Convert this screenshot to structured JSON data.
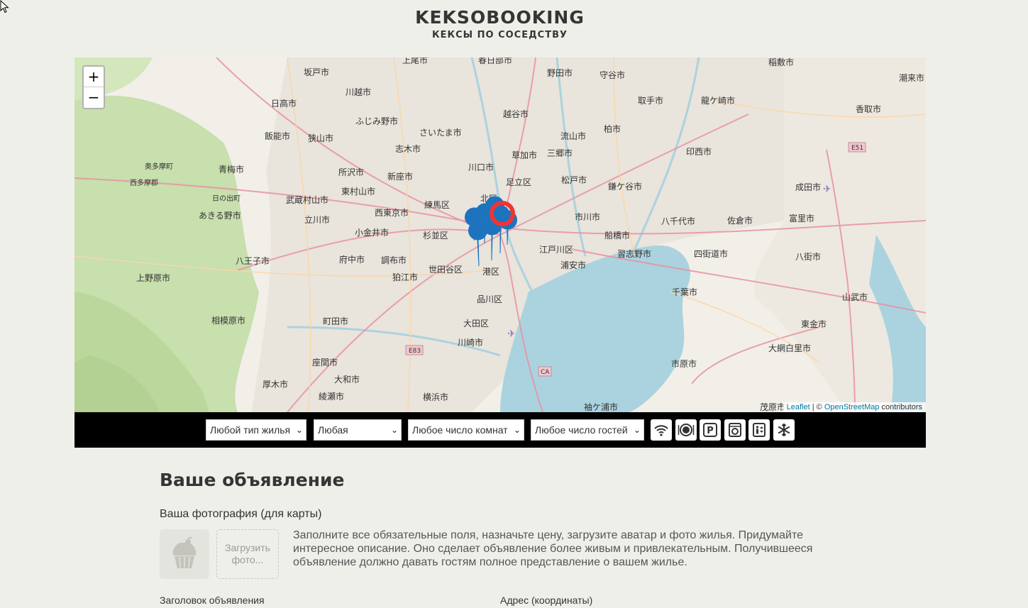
{
  "header": {
    "logo": "KEKSOBOOKING",
    "tagline": "КЕКСЫ ПО СОСЕДСТВУ"
  },
  "map": {
    "zoom_in_label": "+",
    "zoom_out_label": "−",
    "attribution": {
      "leaflet": "Leaflet",
      "separator": " | © ",
      "osm": "OpenStreetMap",
      "suffix": " contributors"
    },
    "main_pin_color": "#ee3535",
    "ad_pin_color": "#1e73be",
    "place_labels": [
      "坂戸市",
      "川越市",
      "日高市",
      "上尾市",
      "春日部市",
      "野田市",
      "守谷市",
      "稲敷市",
      "潮来市",
      "ふじみ野市",
      "越谷市",
      "取手市",
      "龍ケ崎市",
      "飯能市",
      "狭山市",
      "さいたま市",
      "柏市",
      "流山市",
      "志木市",
      "草加市",
      "三郷市",
      "印西市",
      "香取市",
      "奥多摩町",
      "青梅市",
      "所沢市",
      "新座市",
      "川口市",
      "足立区",
      "松戸市",
      "鎌ケ谷市",
      "成田市",
      "東村山市",
      "西多摩郡",
      "日の出町",
      "武蔵村山市",
      "練馬区",
      "北区",
      "市川市",
      "八千代市",
      "佐倉市",
      "富里市",
      "あきる野市",
      "立川市",
      "西東京市",
      "船橋市",
      "小金井市",
      "杉並区",
      "江戸川区",
      "習志野市",
      "四街道市",
      "八街市",
      "八王子市",
      "府中市",
      "調布市",
      "世田谷区",
      "港区",
      "浦安市",
      "上野原市",
      "狛江市",
      "品川区",
      "千葉市",
      "山武市",
      "相模原市",
      "町田市",
      "大田区",
      "東金市",
      "川崎市",
      "大網白里市",
      "座間市",
      "厚木市",
      "大和市",
      "市原市",
      "綾瀬市",
      "横浜市",
      "袖ケ浦市",
      "茂原市"
    ],
    "road_labels": [
      "E51",
      "E83",
      "CA"
    ]
  },
  "filters": {
    "housing_type": "Любой тип жилья",
    "price": "Любая",
    "rooms": "Любое число комнат",
    "guests": "Любое число гостей",
    "features": [
      "wifi-icon",
      "dishwasher-icon",
      "parking-icon",
      "washer-icon",
      "elevator-icon",
      "conditioner-icon"
    ]
  },
  "notice": {
    "title": "Ваше объявление",
    "photo_label": "Ваша фотография (для карты)",
    "upload_label": "Загрузить фото...",
    "hint": "Заполните все обязательные поля, назначьте цену, загрузите аватар и фото жилья. Придумайте интересное описание. Оно сделает объявление более живым и привлекательным. Получившееся объявление должно давать гостям полное представление о вашем жилье.",
    "title_field_label": "Заголовок объявления",
    "address_field_label": "Адрес (координаты)"
  }
}
